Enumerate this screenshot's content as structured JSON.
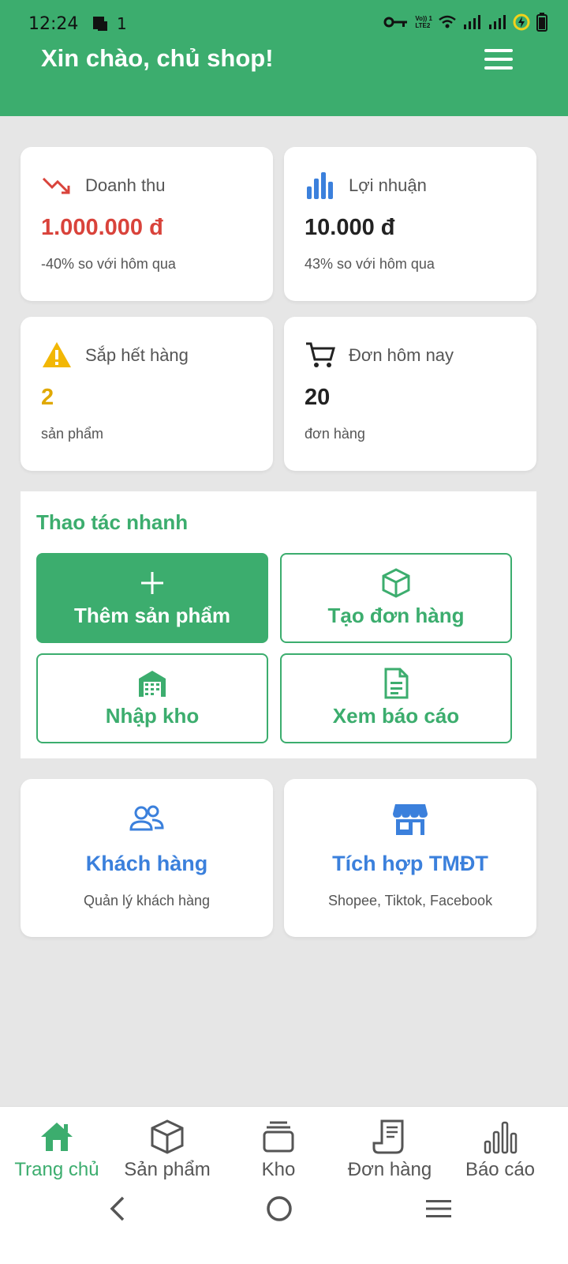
{
  "status_bar": {
    "time": "12:24",
    "notif_count": "1",
    "net_label_top": "Vo)) 1",
    "net_label_bottom": "LTE2"
  },
  "header": {
    "greeting": "Xin chào, chủ shop!"
  },
  "stats": [
    {
      "title": "Doanh thu",
      "value": "1.000.000 đ",
      "sub": "-40% so với hôm qua",
      "icon": "trend-down-icon",
      "value_color": "#d9433b"
    },
    {
      "title": "Lợi nhuận",
      "value": "10.000 đ",
      "sub": "43% so với hôm qua",
      "icon": "bar-chart-icon",
      "value_color": "#222222"
    },
    {
      "title": "Sắp hết hàng",
      "value": "2",
      "sub": "sản phẩm",
      "icon": "warning-icon",
      "value_color": "#e0a800"
    },
    {
      "title": "Đơn hôm nay",
      "value": "20",
      "sub": "đơn hàng",
      "icon": "cart-icon",
      "value_color": "#222222"
    }
  ],
  "quick_actions": {
    "title": "Thao tác nhanh",
    "buttons": [
      {
        "label": "Thêm sản phẩm",
        "icon": "plus-icon",
        "primary": true
      },
      {
        "label": "Tạo đơn hàng",
        "icon": "box-icon",
        "primary": false
      },
      {
        "label": "Nhập kho",
        "icon": "warehouse-icon",
        "primary": false
      },
      {
        "label": "Xem báo cáo",
        "icon": "document-icon",
        "primary": false
      }
    ]
  },
  "features": [
    {
      "title": "Khách hàng",
      "sub": "Quản lý khách hàng",
      "icon": "users-icon"
    },
    {
      "title": "Tích hợp TMĐT",
      "sub": "Shopee, Tiktok, Facebook",
      "icon": "store-icon"
    }
  ],
  "bottom_nav": [
    {
      "label": "Trang chủ",
      "icon": "home-icon",
      "active": true
    },
    {
      "label": "Sản phẩm",
      "icon": "box-icon",
      "active": false
    },
    {
      "label": "Kho",
      "icon": "stack-icon",
      "active": false
    },
    {
      "label": "Đơn hàng",
      "icon": "receipt-icon",
      "active": false
    },
    {
      "label": "Báo cáo",
      "icon": "bar-chart-icon",
      "active": false
    }
  ],
  "colors": {
    "brand": "#3cad6e",
    "accent_blue": "#3b80dc",
    "negative": "#d9433b",
    "warning": "#e0a800",
    "background": "#e6e6e6"
  }
}
